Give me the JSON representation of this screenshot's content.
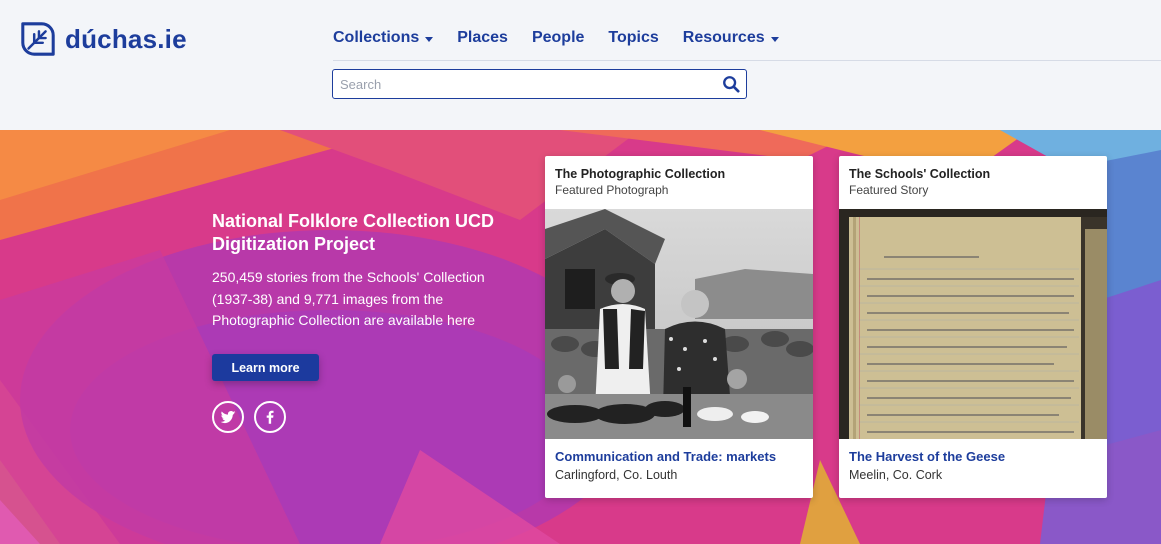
{
  "brand": {
    "name": "dúchas.ie",
    "color": "#1d3d9c"
  },
  "nav": {
    "items": [
      {
        "label": "Collections",
        "dropdown": true
      },
      {
        "label": "Places",
        "dropdown": false
      },
      {
        "label": "People",
        "dropdown": false
      },
      {
        "label": "Topics",
        "dropdown": false
      },
      {
        "label": "Resources",
        "dropdown": true
      }
    ]
  },
  "search": {
    "placeholder": "Search",
    "value": ""
  },
  "hero": {
    "title": "National Folklore Collection UCD Digitization Project",
    "description": "250,459 stories from the Schools' Collection (1937-38) and 9,771 images from the Photographic Collection are available here",
    "button_label": "Learn more",
    "social": [
      "twitter-icon",
      "facebook-icon"
    ]
  },
  "cards": [
    {
      "title": "The Photographic Collection",
      "subtitle": "Featured Photograph",
      "link": "Communication and Trade: markets",
      "place": "Carlingford, Co. Louth"
    },
    {
      "title": "The Schools' Collection",
      "subtitle": "Featured Story",
      "link": "The Harvest of the Geese",
      "place": "Meelin, Co. Cork"
    }
  ],
  "colors": {
    "accent": "#1d3d9c",
    "hero_pink": "#d43a8e",
    "button": "#1c3a9e"
  }
}
